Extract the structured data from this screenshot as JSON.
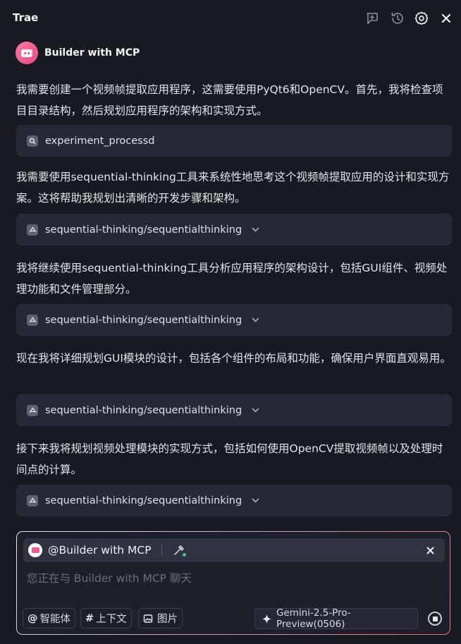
{
  "header": {
    "title": "Trae",
    "icons": [
      "new-chat-icon",
      "history-icon",
      "settings-icon",
      "close-icon"
    ]
  },
  "agent": {
    "name": "Builder with MCP",
    "avatar_color": "#e44a7f"
  },
  "messages": [
    {
      "type": "text",
      "content": "我需要创建一个视频帧提取应用程序，这需要使用PyQt6和OpenCV。首先，我将检查项目目录结构，然后规划应用程序的架构和实现方式。"
    },
    {
      "type": "tool",
      "icon": "search-icon",
      "label": "experiment_processd"
    },
    {
      "type": "text",
      "content": "我需要使用sequential-thinking工具来系统性地思考这个视频帧提取应用的设计和实现方案。这将帮助我规划出清晰的开发步骤和架构。"
    },
    {
      "type": "tool",
      "icon": "mcp-icon",
      "label": "sequential-thinking/sequentialthinking"
    },
    {
      "type": "text",
      "content": "我将继续使用sequential-thinking工具分析应用程序的架构设计，包括GUI组件、视频处理功能和文件管理部分。"
    },
    {
      "type": "tool",
      "icon": "mcp-icon",
      "label": "sequential-thinking/sequentialthinking"
    },
    {
      "type": "text",
      "content": "现在我将详细规划GUI模块的设计，包括各个组件的布局和功能，确保用户界面直观易用。"
    },
    {
      "type": "tool",
      "icon": "mcp-icon",
      "label": "sequential-thinking/sequentialthinking"
    },
    {
      "type": "text",
      "content": "接下来我将规划视频处理模块的实现方式，包括如何使用OpenCV提取视频帧以及处理时间点的计算。"
    },
    {
      "type": "tool",
      "icon": "mcp-icon",
      "label": "sequential-thinking/sequentialthinking"
    }
  ],
  "composer": {
    "mention": "@Builder with MCP",
    "placeholder": "您正在与 Builder with MCP 聊天",
    "chips": [
      {
        "icon": "at-icon",
        "glyph": "@",
        "label": "智能体"
      },
      {
        "icon": "hash-icon",
        "glyph": "#",
        "label": "上下文"
      },
      {
        "icon": "image-icon",
        "label": "图片"
      }
    ],
    "model": "Gemini-2.5-Pro-Preview(0506)",
    "accent_gradient": [
      "#e9e9ee",
      "#f06a70"
    ]
  }
}
